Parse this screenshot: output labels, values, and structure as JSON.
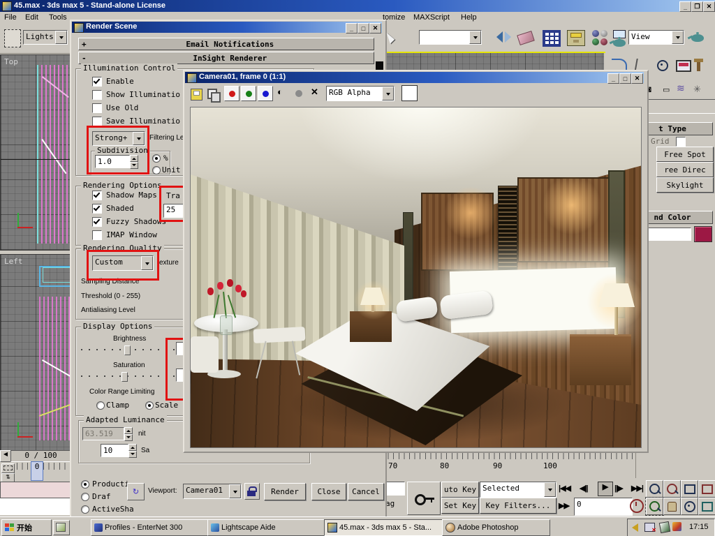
{
  "app": {
    "title": "45.max - 3ds max 5 - Stand-alone License",
    "time": "17:15"
  },
  "menus": {
    "file": "File",
    "edit": "Edit",
    "tools": "Tools",
    "customize": "tomize",
    "maxscript": "MAXScript",
    "help": "Help"
  },
  "toolbar": {
    "lights": "Lights",
    "view": "View"
  },
  "viewports": {
    "top": "Top",
    "left": "Left",
    "frame_readout": "0 / 100",
    "trackbar_zero": "0"
  },
  "panel": {
    "object_type": "t Type",
    "grid": "Grid",
    "free_spot": "Free Spot",
    "free_direct": "ree Direc",
    "skylight": "Skylight",
    "name_color": "nd Color",
    "swatch": "#9c1844"
  },
  "dialog": {
    "title": "Render Scene",
    "rollout_email_state": "+",
    "rollout_email": "Email Notifications",
    "rollout_insight_state": "-",
    "rollout_insight": "InSight Renderer",
    "illum": {
      "group": "Illumination Control",
      "cb": [
        {
          "label": "Enable",
          "checked": true
        },
        {
          "label": "Show Illuminatio",
          "checked": false
        },
        {
          "label": "Use Old",
          "checked": false
        },
        {
          "label": "Save Illuminatio",
          "checked": false
        }
      ],
      "preset": "Strong+",
      "filtering": "Filtering Le",
      "sub_group": "Subdivision",
      "sub_value": "1.0",
      "pct": "%",
      "unit": "Unit"
    },
    "ropt": {
      "group": "Rendering Options",
      "cb": [
        {
          "label": "Shadow Maps",
          "checked": true
        },
        {
          "label": "Shaded",
          "checked": true
        },
        {
          "label": "Fuzzy Shadows",
          "checked": true
        },
        {
          "label": "IMAP Window",
          "checked": false
        }
      ],
      "tra": "Tra",
      "tra_value": "25"
    },
    "quality": {
      "group": "Rendering Quality",
      "value": "Custom",
      "texture": "exture",
      "rows": [
        "Sampling Distance",
        "Threshold (0 - 255)",
        "Antialiasing Level"
      ]
    },
    "display": {
      "group": "Display Options",
      "brightness": "Brightness",
      "saturation": "Saturation",
      "color_range": "Color Range Limiting",
      "clamp": "Clamp",
      "scale": "Scale"
    },
    "lum": {
      "group": "Adapted Luminance",
      "value": "63.519",
      "nit": "nit",
      "value2": "10",
      "sa": "Sa"
    },
    "footer": {
      "production": "Producti",
      "draft": "Draf",
      "activeshade": "ActiveSha",
      "viewport_label": "Viewport:",
      "viewport": "Camera01",
      "render": "Render",
      "close": "Close",
      "cancel": "Cancel"
    }
  },
  "camera": {
    "title": "Camera01, frame 0 (1:1)",
    "channels": "RGB Alpha"
  },
  "timeline": {
    "t70": "70",
    "t80": "80",
    "t90": "90",
    "t100": "100"
  },
  "status": {
    "auto_key": "uto Key",
    "set_key": "Set Key",
    "selected": "Selected",
    "key_filters": "Key Filters...",
    "frame": "0",
    "tag": "ag"
  },
  "taskbar": {
    "start": "开始",
    "task1": "Profiles - EnterNet 300",
    "task2": "Lightscape Aide",
    "task3": "45.max - 3ds max 5 - Sta...",
    "task4": "Adobe Photoshop"
  },
  "colors": {
    "annotation": "#e11212",
    "swatch": "#9c1844"
  }
}
